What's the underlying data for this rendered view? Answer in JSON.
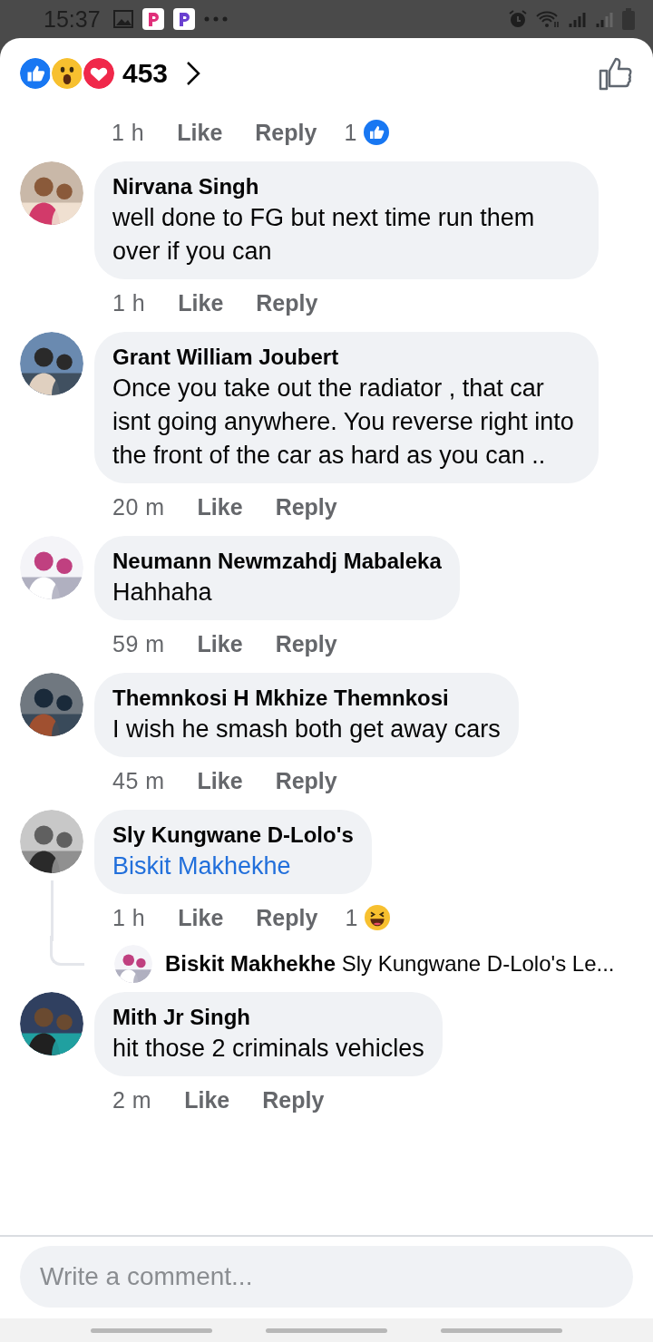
{
  "status_bar": {
    "time": "15:37"
  },
  "reactions_summary": {
    "reactions": [
      {
        "kind": "like"
      },
      {
        "kind": "wow"
      },
      {
        "kind": "love"
      }
    ],
    "count": "453"
  },
  "top_meta": {
    "time": "1 h",
    "like_label": "Like",
    "reply_label": "Reply",
    "reaction_count": "1",
    "reaction": {
      "kind": "like"
    }
  },
  "comments": [
    {
      "author": "Nirvana Singh",
      "text": "well done to FG but next time run them over if you can",
      "time": "1 h",
      "like_label": "Like",
      "reply_label": "Reply"
    },
    {
      "author": "Grant William Joubert",
      "text": "Once you take out the radiator , that car isnt going anywhere. You reverse right into the front of the car as hard as you can ..",
      "time": "20 m",
      "like_label": "Like",
      "reply_label": "Reply"
    },
    {
      "author": "Neumann Newmzahdj Mabaleka",
      "text": "Hahhaha",
      "time": "59 m",
      "like_label": "Like",
      "reply_label": "Reply"
    },
    {
      "author": "Themnkosi H Mkhize Themnkosi",
      "text": "I wish he smash both get away cars",
      "time": "45 m",
      "like_label": "Like",
      "reply_label": "Reply"
    },
    {
      "author": "Sly Kungwane D-Lolo's",
      "mention": "Biskit Makhekhe",
      "time": "1 h",
      "like_label": "Like",
      "reply_label": "Reply",
      "reaction_count": "1",
      "reaction": {
        "kind": "haha"
      },
      "replies": [
        {
          "author": "Biskit Makhekhe",
          "text": "Sly Kungwane D-Lolo's Le..."
        }
      ]
    },
    {
      "author": "Mith Jr Singh",
      "text": "hit those 2 criminals vehicles",
      "time": "2 m",
      "like_label": "Like",
      "reply_label": "Reply"
    }
  ],
  "composer": {
    "placeholder": "Write a comment..."
  }
}
